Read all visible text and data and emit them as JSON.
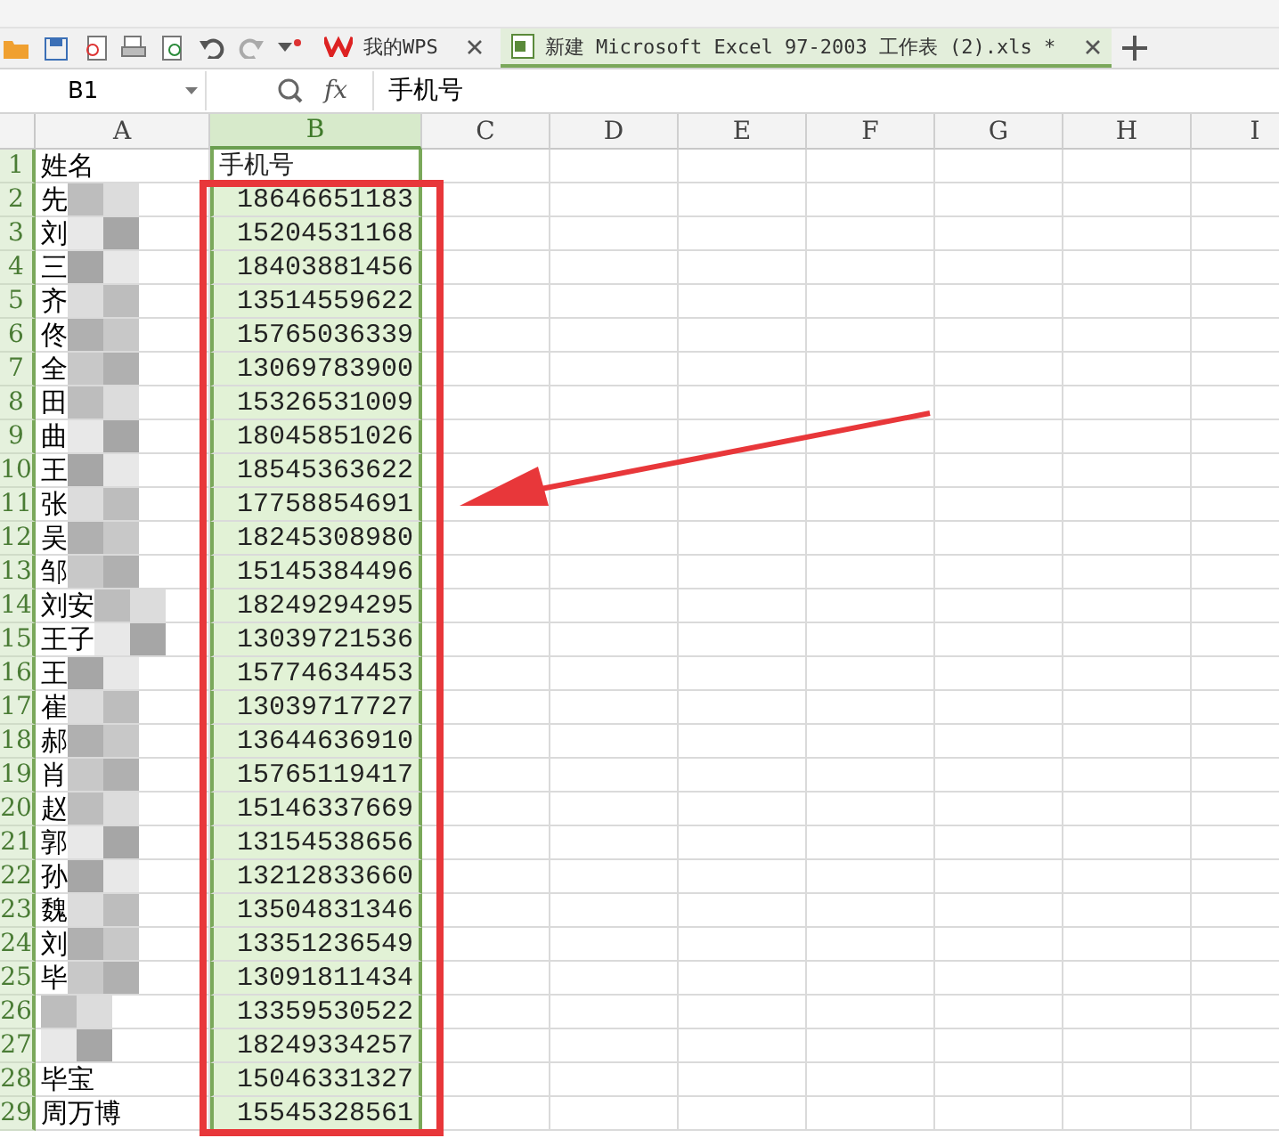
{
  "tabs": [
    {
      "label": "我的WPS",
      "selected": false
    },
    {
      "label": "新建 Microsoft Excel 97-2003 工作表 (2).xls *",
      "selected": true
    }
  ],
  "formula_bar": {
    "name_box": "B1",
    "fx": "fx",
    "value": "手机号"
  },
  "columns": [
    {
      "label": "A",
      "selected": false
    },
    {
      "label": "B",
      "selected": true
    },
    {
      "label": "C",
      "selected": false
    },
    {
      "label": "D",
      "selected": false
    },
    {
      "label": "E",
      "selected": false
    },
    {
      "label": "F",
      "selected": false
    },
    {
      "label": "G",
      "selected": false
    },
    {
      "label": "H",
      "selected": false
    },
    {
      "label": "I",
      "selected": false
    }
  ],
  "rows": [
    {
      "number": "1",
      "a": "姓名",
      "b": "手机号",
      "active": true
    },
    {
      "number": "2",
      "a": "先",
      "b": "18646651183",
      "active": false
    },
    {
      "number": "3",
      "a": "刘",
      "b": "15204531168",
      "active": false
    },
    {
      "number": "4",
      "a": "三",
      "b": "18403881456",
      "active": false
    },
    {
      "number": "5",
      "a": "齐",
      "b": "13514559622",
      "active": false
    },
    {
      "number": "6",
      "a": "佟",
      "b": "15765036339",
      "active": false
    },
    {
      "number": "7",
      "a": "全",
      "b": "13069783900",
      "active": false
    },
    {
      "number": "8",
      "a": "田",
      "b": "15326531009",
      "active": false
    },
    {
      "number": "9",
      "a": "曲",
      "b": "18045851026",
      "active": false
    },
    {
      "number": "10",
      "a": "王",
      "b": "18545363622",
      "active": false
    },
    {
      "number": "11",
      "a": "张",
      "b": "17758854691",
      "active": false
    },
    {
      "number": "12",
      "a": "吴",
      "b": "18245308980",
      "active": false
    },
    {
      "number": "13",
      "a": "邹",
      "b": "15145384496",
      "active": false
    },
    {
      "number": "14",
      "a": "刘安",
      "b": "18249294295",
      "active": false
    },
    {
      "number": "15",
      "a": "王子",
      "b": "13039721536",
      "active": false
    },
    {
      "number": "16",
      "a": "王",
      "b": "15774634453",
      "active": false
    },
    {
      "number": "17",
      "a": "崔",
      "b": "13039717727",
      "active": false
    },
    {
      "number": "18",
      "a": "郝",
      "b": "13644636910",
      "active": false
    },
    {
      "number": "19",
      "a": "肖",
      "b": "15765119417",
      "active": false
    },
    {
      "number": "20",
      "a": "赵",
      "b": "15146337669",
      "active": false
    },
    {
      "number": "21",
      "a": "郭",
      "b": "13154538656",
      "active": false
    },
    {
      "number": "22",
      "a": "孙",
      "b": "13212833660",
      "active": false
    },
    {
      "number": "23",
      "a": "魏",
      "b": "13504831346",
      "active": false
    },
    {
      "number": "24",
      "a": "刘",
      "b": "13351236549",
      "active": false
    },
    {
      "number": "25",
      "a": "毕",
      "b": "13091811434",
      "active": false
    },
    {
      "number": "26",
      "b": "13359530522",
      "active": false
    },
    {
      "number": "27",
      "b": "18249334257",
      "active": false
    },
    {
      "number": "28",
      "a": "毕宝",
      "b": "15046331327",
      "active": false
    },
    {
      "number": "29",
      "a": "周万博",
      "b": "15545328561",
      "active": false
    }
  ]
}
